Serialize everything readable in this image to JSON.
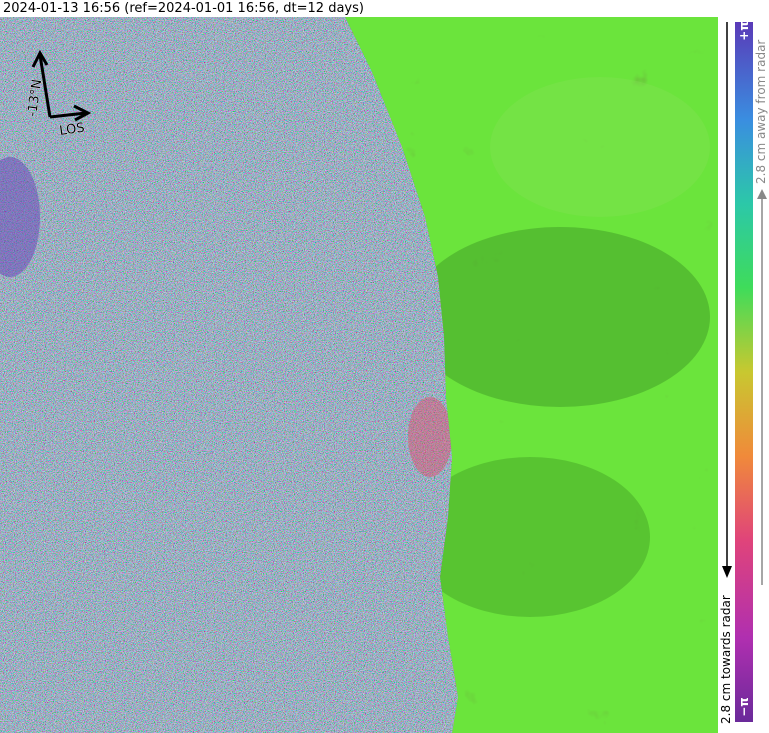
{
  "title": "2024-01-13 16:56 (ref=2024-01-01 16:56, dt=12 days)",
  "map": {
    "north_arrow_label": "-13°N",
    "los_label": "LOS",
    "colors": {
      "land": "#5ec43a",
      "land_shadow": "#2f7a1c",
      "land_highlight": "#8fe060"
    }
  },
  "colorbar": {
    "top_tick": "+π",
    "bottom_tick": "−π",
    "away_label": "2.8 cm away from radar",
    "toward_label": "2.8 cm towards radar",
    "colors": [
      "#6a2a9a",
      "#b02fb0",
      "#e0447a",
      "#f08a3a",
      "#c8c830",
      "#3fdc5a",
      "#2cc8a8",
      "#3a8ee0",
      "#5a3ab8"
    ]
  }
}
